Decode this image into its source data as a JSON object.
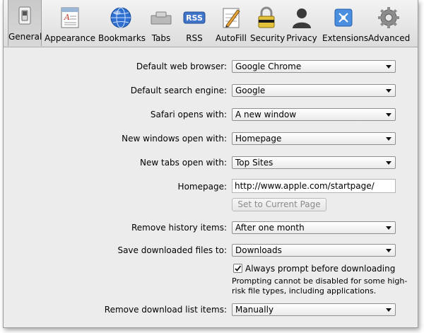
{
  "toolbar": {
    "items": [
      {
        "label": "General",
        "icon": "light-switch-icon",
        "selected": true
      },
      {
        "label": "Appearance",
        "icon": "appearance-document-icon"
      },
      {
        "label": "Bookmarks",
        "icon": "globe-icon"
      },
      {
        "label": "Tabs",
        "icon": "tabs-icon"
      },
      {
        "label": "RSS",
        "icon": "rss-icon"
      },
      {
        "label": "AutoFill",
        "icon": "pencil-form-icon"
      },
      {
        "label": "Security",
        "icon": "padlock-icon"
      },
      {
        "label": "Privacy",
        "icon": "person-silhouette-icon"
      },
      {
        "label": "Extensions",
        "icon": "puzzle-icon"
      },
      {
        "label": "Advanced",
        "icon": "gear-icon"
      }
    ],
    "rss_badge_text": "RSS"
  },
  "settings": {
    "default_browser": {
      "label": "Default web browser:",
      "value": "Google Chrome"
    },
    "search_engine": {
      "label": "Default search engine:",
      "value": "Google"
    },
    "safari_opens": {
      "label": "Safari opens with:",
      "value": "A new window"
    },
    "new_windows": {
      "label": "New windows open with:",
      "value": "Homepage"
    },
    "new_tabs": {
      "label": "New tabs open with:",
      "value": "Top Sites"
    },
    "homepage": {
      "label": "Homepage:",
      "value": "http://www.apple.com/startpage/"
    },
    "set_current_page": {
      "label": "Set to Current Page"
    },
    "remove_history": {
      "label": "Remove history items:",
      "value": "After one month"
    },
    "save_downloads": {
      "label": "Save downloaded files to:",
      "value": "Downloads"
    },
    "always_prompt": {
      "label": "Always prompt before downloading",
      "checked": true
    },
    "prompt_note_line1": "Prompting cannot be disabled for some high-",
    "prompt_note_line2": "risk file types, including applications.",
    "remove_download_list": {
      "label": "Remove download list items:",
      "value": "Manually"
    }
  }
}
